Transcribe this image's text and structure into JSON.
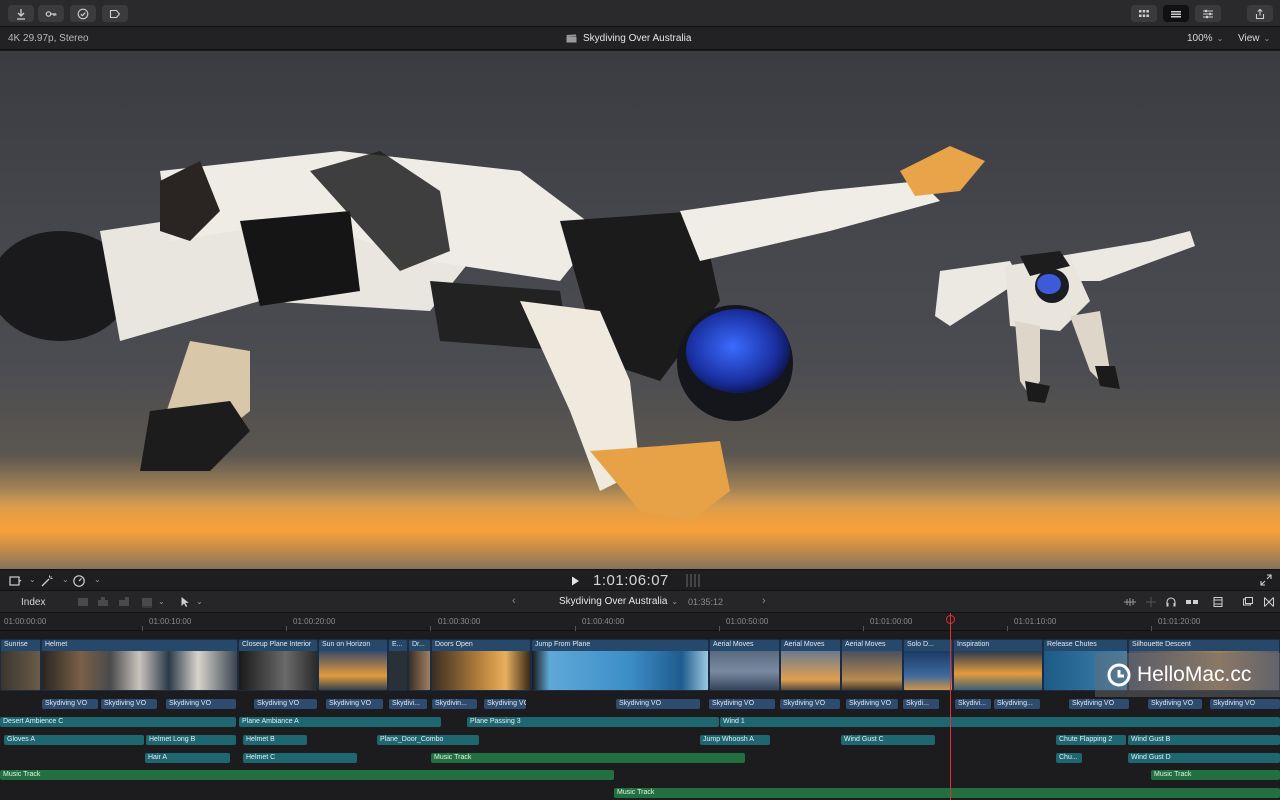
{
  "viewer": {
    "format_info": "4K 29.97p, Stereo",
    "project_title": "Skydiving Over Australia",
    "zoom_level": "100%",
    "view_menu": "View"
  },
  "playback": {
    "timecode": "1:01:06:07"
  },
  "timeline": {
    "index_label": "Index",
    "title": "Skydiving Over Australia",
    "duration": "01:35:12",
    "ruler": [
      "01:00:00:00",
      "01:00:10:00",
      "01:00:20:00",
      "01:00:30:00",
      "01:00:40:00",
      "01:00:50:00",
      "01:01:00:00",
      "01:01:10:00",
      "01:01:20:00"
    ],
    "primary_clips": [
      {
        "label": "Sunrise"
      },
      {
        "label": "Helmet"
      },
      {
        "label": "Closeup Plane Interior"
      },
      {
        "label": "Sun on Horizon"
      },
      {
        "label": "E..."
      },
      {
        "label": "Dr..."
      },
      {
        "label": "Doors Open"
      },
      {
        "label": "Jump From Plane"
      },
      {
        "label": "Aerial Moves"
      },
      {
        "label": "Aerial Moves"
      },
      {
        "label": "Aerial Moves"
      },
      {
        "label": "Solo D..."
      },
      {
        "label": "Inspiration"
      },
      {
        "label": "Release Chutes"
      },
      {
        "label": "Silhouette Descent"
      }
    ],
    "vo_clips": [
      "Skydiving VO",
      "Skydiving VO",
      "Skydiving VO",
      "Skydiving VO",
      "Skydiving VO",
      "Skydivi...",
      "Skydivin...",
      "Skydiving VO",
      "Skydiving VO",
      "Skydiving VO",
      "Skydiving VO",
      "Skydiving VO",
      "Skydi...",
      "Skydivi...",
      "Skydiving...",
      "Skydiving VO",
      "Skydiving VO",
      "Skydiving VO"
    ],
    "sfx_row1": [
      "Desert Ambience C",
      "Plane Ambiance A",
      "Plane Passing 3",
      "Wind 1"
    ],
    "sfx_row2": [
      "Gloves A",
      "Helmet Long B",
      "Helmet B",
      "Plane_Door_Combo",
      "Jump Whoosh A",
      "Wind Gust C",
      "Chute Flapping 2",
      "Wind Gust B"
    ],
    "sfx_row3": [
      "Hair A",
      "Helmet C",
      "Music Track",
      "Chu...",
      "Wind Gust D"
    ],
    "music_row1": [
      "Music Track",
      "Music Track"
    ],
    "music_row2": [
      "Music Track"
    ]
  },
  "watermark": {
    "text": "HelloMac.cc"
  },
  "icons": {
    "toolbar_left": [
      "download-icon",
      "key-icon",
      "checkmark-icon",
      "tag-icon"
    ],
    "toolbar_right": [
      "grid-icon",
      "timeline-layout-icon",
      "sliders-icon",
      "share-icon"
    ]
  },
  "colors": {
    "vo_clip": "#2e4b70",
    "sfx_clip": "#1e6670",
    "music_clip": "#22703f",
    "playhead": "#dd3333"
  }
}
